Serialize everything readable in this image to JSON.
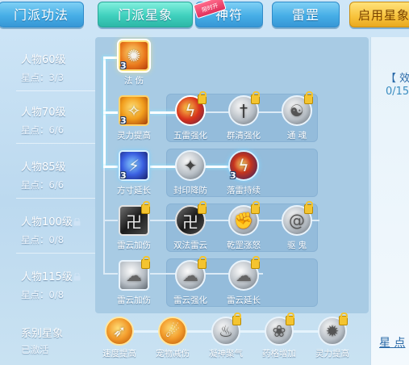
{
  "tabs": [
    {
      "label": "门派功法",
      "state": "normal"
    },
    {
      "label": "门派星象",
      "state": "active"
    },
    {
      "label": "神符",
      "state": "normal",
      "badge": "限时开"
    },
    {
      "label": "雷罡",
      "state": "normal"
    },
    {
      "label": "启用星象",
      "state": "gold"
    }
  ],
  "rows": [
    {
      "level": "人物60级",
      "stars": "星点：3/3"
    },
    {
      "level": "人物70级",
      "stars": "星点：6/6"
    },
    {
      "level": "人物85级",
      "stars": "星点：6/6"
    },
    {
      "level": "人物100级",
      "stars": "星点：0/8",
      "locked": true
    },
    {
      "level": "人物115级",
      "stars": "星点：0/8",
      "locked": true
    }
  ],
  "skills": {
    "r1": [
      {
        "name": "法 伤",
        "num": "3",
        "icon": "fire-body-icon"
      }
    ],
    "r2": [
      {
        "name": "灵力提高",
        "num": "3",
        "icon": "spark-hand-icon"
      },
      {
        "name": "五雷强化",
        "icon": "thunder-seal-icon",
        "locked": true
      },
      {
        "name": "群清强化",
        "icon": "sword-icon",
        "locked": true
      },
      {
        "name": "通 魂",
        "icon": "spirit-icon",
        "locked": true
      }
    ],
    "r3": [
      {
        "name": "方寸延长",
        "num": "3",
        "icon": "lightning-icon"
      },
      {
        "name": "封印降防",
        "icon": "seal-icon"
      },
      {
        "name": "落雷持续",
        "num": "3",
        "icon": "thunder-icon"
      }
    ],
    "r4": [
      {
        "name": "雷云加伤",
        "icon": "talisman-icon",
        "locked": true
      },
      {
        "name": "双法雷云",
        "icon": "talisman-icon",
        "locked": true
      },
      {
        "name": "乾罡涨怒",
        "icon": "fist-icon",
        "locked": true
      },
      {
        "name": "驱 鬼",
        "icon": "swirl-icon",
        "locked": true
      }
    ],
    "r5": [
      {
        "name": "雷云加伤",
        "icon": "cloud-hand-icon",
        "locked": true
      },
      {
        "name": "雷云强化",
        "icon": "cloud-hand-icon",
        "locked": true
      },
      {
        "name": "雷云延长",
        "icon": "cloud-hand-icon",
        "locked": true
      }
    ]
  },
  "series": {
    "title": "系别星象",
    "status": "已激活",
    "items": [
      {
        "name": "速度提高",
        "icon": "speed-icon",
        "style": "orange"
      },
      {
        "name": "宠物减伤",
        "icon": "pet-shield-icon",
        "style": "orange"
      },
      {
        "name": "凝神聚气",
        "icon": "focus-icon",
        "locked": true
      },
      {
        "name": "药格增加",
        "icon": "herb-icon",
        "locked": true
      },
      {
        "name": "灵力提高",
        "icon": "mana-icon",
        "locked": true
      }
    ]
  },
  "right_panel": {
    "effect_label": "【 效果",
    "progress": "0/15",
    "star_link": "星 点"
  }
}
